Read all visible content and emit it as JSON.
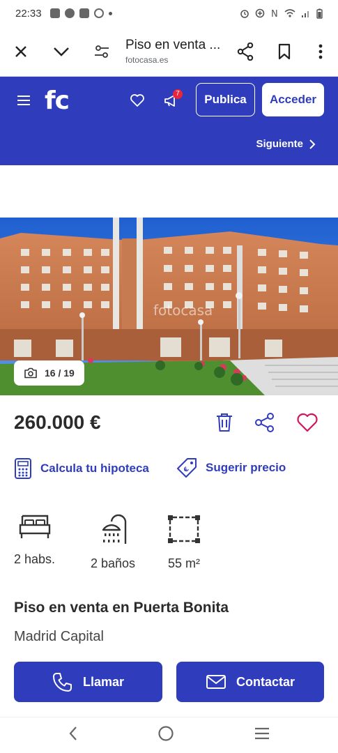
{
  "status_bar": {
    "time": "22:33"
  },
  "browser": {
    "page_title": "Piso en venta ...",
    "host": "fotocasa.es"
  },
  "site_header": {
    "logo": "fc",
    "notifications_count": "7",
    "publica_label": "Publica",
    "acceder_label": "Acceder",
    "siguiente_label": "Siguiente"
  },
  "gallery": {
    "counter": "16 / 19",
    "watermark": "fotocasa"
  },
  "listing": {
    "price": "260.000 €",
    "calc_mortgage_label": "Calcula tu hipoteca",
    "suggest_price_label": "Sugerir precio",
    "features": [
      {
        "label": "2 habs.",
        "icon": "bed-icon"
      },
      {
        "label": "2 baños",
        "icon": "shower-icon"
      },
      {
        "label": "55 m²",
        "icon": "area-icon"
      }
    ],
    "title": "Piso en venta en Puerta Bonita",
    "location": "Madrid Capital"
  },
  "actions": {
    "call_label": "Llamar",
    "contact_label": "Contactar"
  },
  "colors": {
    "brand_blue": "#2f3dbd",
    "heart_pink": "#d4145a",
    "badge_red": "#e8253a"
  }
}
